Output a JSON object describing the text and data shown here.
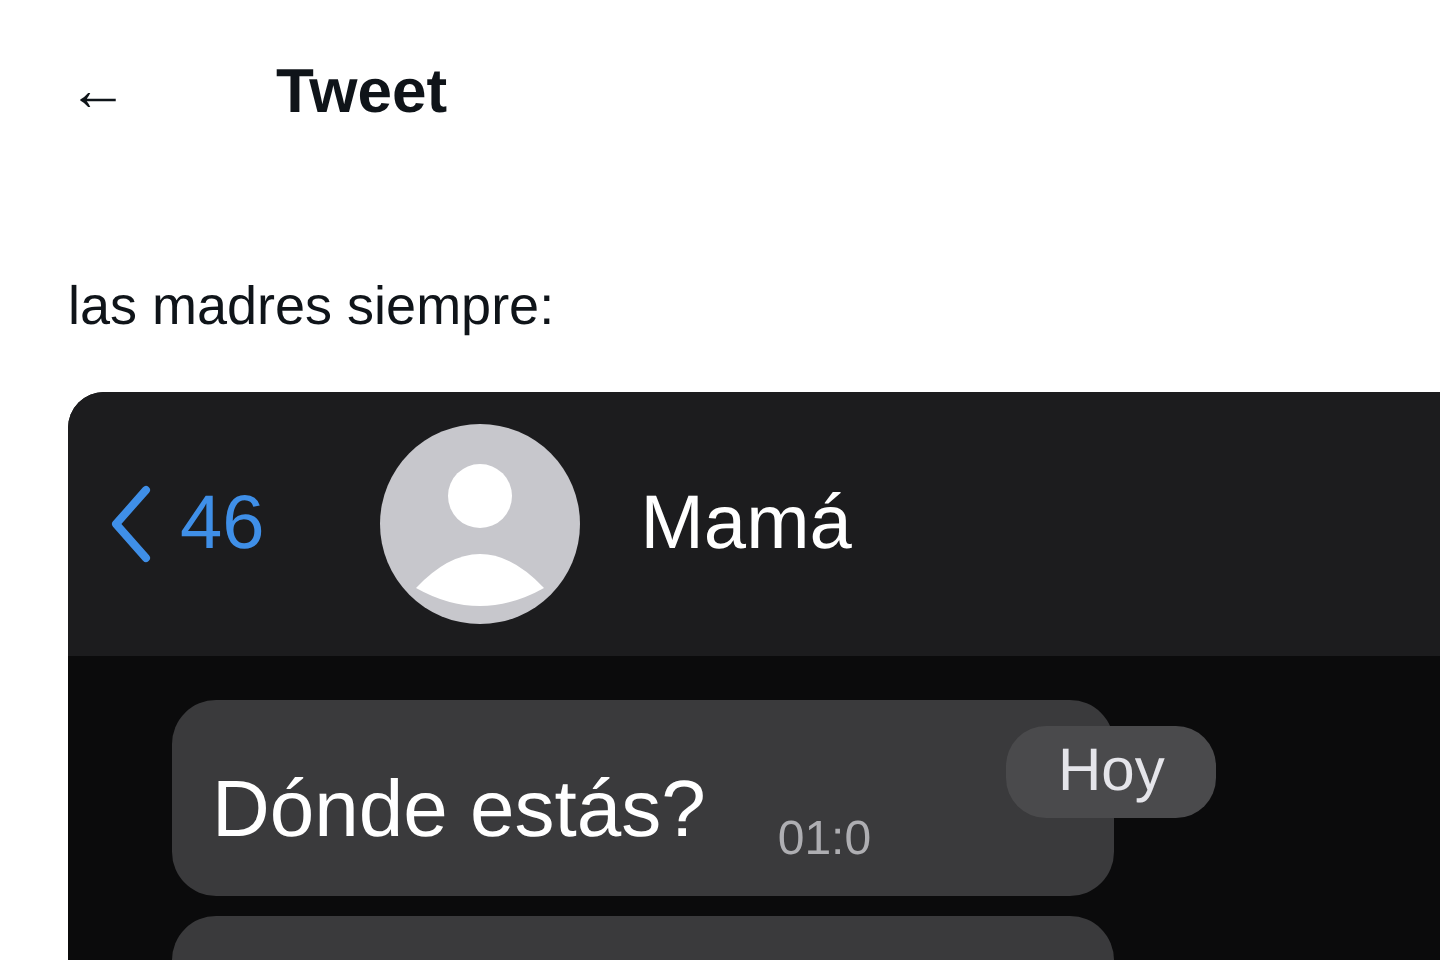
{
  "header": {
    "back_icon": "←",
    "title": "Tweet"
  },
  "tweet": {
    "text": "las madres siempre:"
  },
  "chat": {
    "back": {
      "count": "46"
    },
    "contact": "Mamá",
    "messages": [
      {
        "kind": "message",
        "text": "Dónde estás?",
        "time": "01:0"
      },
      {
        "kind": "message"
      }
    ],
    "date_pill": "Hoy"
  }
}
